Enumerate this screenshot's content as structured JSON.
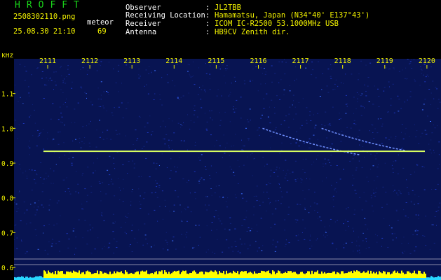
{
  "header": {
    "app_title": "HROFFT",
    "filename": "2508302110.png",
    "datetime": "25.08.30 21:10",
    "event_type": "meteor",
    "event_count": "69",
    "info": [
      {
        "label": "Observer",
        "value": "JL2TBB"
      },
      {
        "label": "Receiving Location",
        "value": "Hamamatsu, Japan (N34°40' E137°43')"
      },
      {
        "label": "Receiver",
        "value": "ICOM IC-R2500 53.1000MHz USB"
      },
      {
        "label": "Antenna",
        "value": "HB9CV Zenith dir."
      }
    ],
    "separator": ":"
  },
  "colors": {
    "background": "#000000",
    "text_yellow": "#f2f200",
    "text_white": "#ffffff",
    "title_green": "#19d419",
    "spectrum_blue": "#0a1a6e",
    "carrier_line": "#d8ff60",
    "amplitude_yellow": "#ffff00",
    "amplitude_cyan": "#29d6ff"
  },
  "chart_data": {
    "type": "heatmap",
    "ylabel": "kHz",
    "x": [
      "2111",
      "2112",
      "2113",
      "2114",
      "2115",
      "2116",
      "2117",
      "2118",
      "2119",
      "2120"
    ],
    "y": [
      "1.1",
      "1.0",
      "0.9",
      "0.8",
      "0.7",
      "0.6"
    ],
    "ylim": [
      0.58,
      1.2
    ],
    "carrier_frequency_khz": 0.934,
    "meteor_traces": [
      {
        "x_start": "2116.1",
        "x_end": "2118.4",
        "f_start_khz": 1.0,
        "f_end_khz": 0.924
      },
      {
        "x_start": "2117.5",
        "x_end": "2119.5",
        "f_start_khz": 1.0,
        "f_end_khz": 0.936
      }
    ],
    "grid": false
  }
}
